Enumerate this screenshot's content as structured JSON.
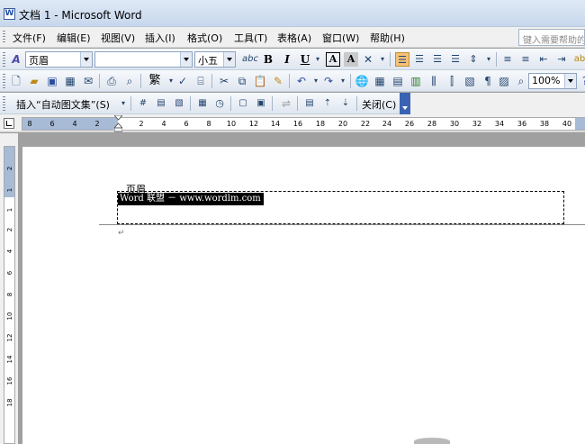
{
  "window": {
    "title": "文档 1 - Microsoft Word",
    "app_icon": "W"
  },
  "menubar": {
    "items": [
      "文件(F)",
      "编辑(E)",
      "视图(V)",
      "插入(I)",
      "格式(O)",
      "工具(T)",
      "表格(A)",
      "窗口(W)",
      "帮助(H)"
    ],
    "help_placeholder": "键入需要帮助的"
  },
  "format_toolbar": {
    "style_icon": "A",
    "style_value": "页眉",
    "font_value": "",
    "size_value": "小五",
    "char_scale_icon": "abc",
    "bold": "B",
    "italic": "I",
    "underline": "U",
    "char_border": "A",
    "char_shading": "A",
    "accent_color": "#f5c27a"
  },
  "standard_toolbar": {
    "traditional_label": "繁",
    "zoom_value": "100%"
  },
  "header_footer_toolbar": {
    "insert_autotext_label": "插入“自动图文集”(S)",
    "close_label": "关闭(C)"
  },
  "ruler": {
    "h_ticks": [
      "8",
      "6",
      "4",
      "2",
      "2",
      "4",
      "6",
      "8",
      "10",
      "12",
      "14",
      "16",
      "18",
      "20",
      "22",
      "24",
      "26",
      "28",
      "30",
      "32",
      "34",
      "36",
      "38",
      "40"
    ],
    "v_ticks": [
      "2",
      "1",
      "1",
      "2",
      "4",
      "6",
      "8",
      "10",
      "12",
      "14",
      "16",
      "18"
    ]
  },
  "document": {
    "header_label": "页眉",
    "header_text": "Word 联盟 － www.wordlm.com",
    "para_mark": "↵"
  }
}
